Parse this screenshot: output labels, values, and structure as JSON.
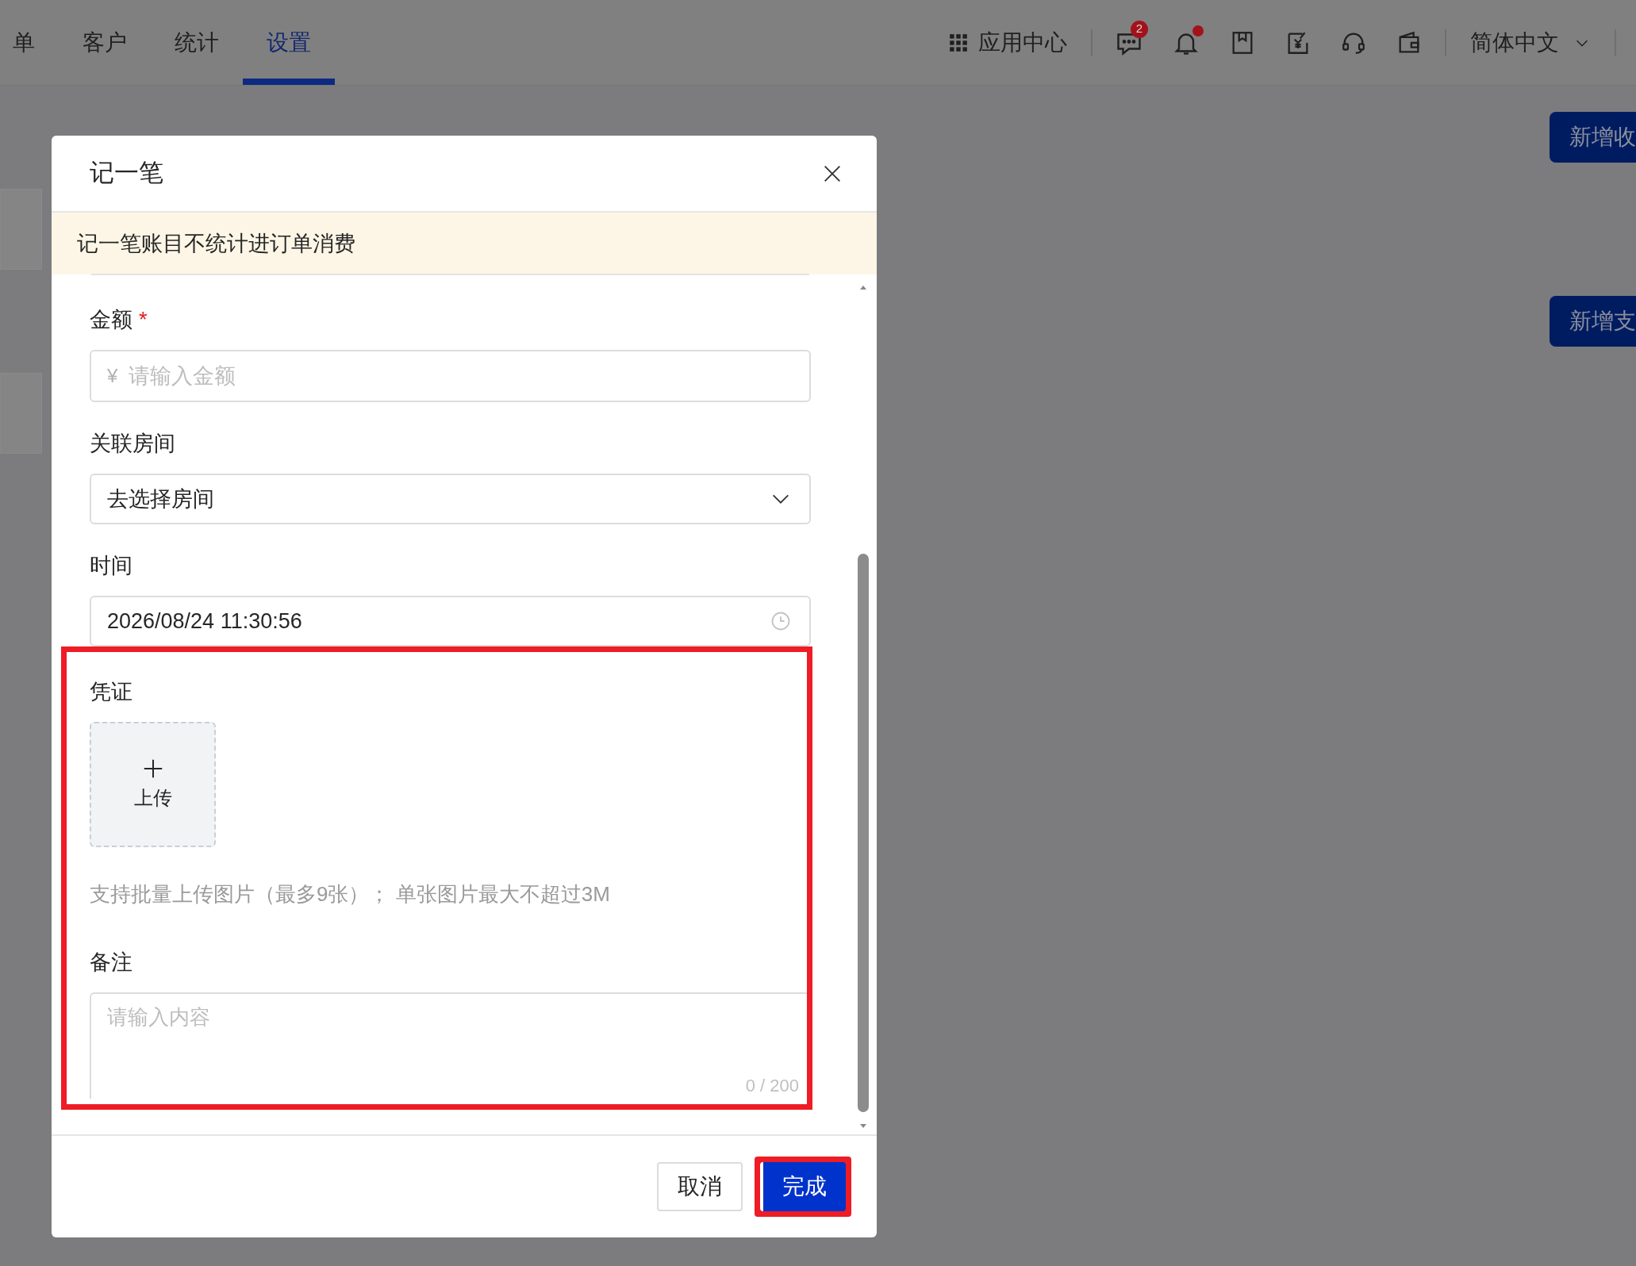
{
  "top_nav": {
    "tabs": [
      {
        "label": "单",
        "selected": false
      },
      {
        "label": "客户",
        "selected": false
      },
      {
        "label": "统计",
        "selected": false
      },
      {
        "label": "设置",
        "selected": true
      }
    ],
    "app_center": "应用中心",
    "message_badge": "2",
    "notification_dot": true,
    "language": "简体中文"
  },
  "page_buttons": [
    "新增收",
    "新增支"
  ],
  "dialog": {
    "title": "记一笔",
    "notice": "记一笔账目不统计进订单消费",
    "fields": [
      {
        "kind": "amount",
        "label": "金额",
        "required": true,
        "required_mark": "*",
        "prefix": "¥",
        "placeholder": "请输入金额",
        "highlighted": false
      },
      {
        "kind": "select",
        "label": "关联房间",
        "value": "去选择房间",
        "highlighted": false
      },
      {
        "kind": "datetime",
        "label": "时间",
        "value": "2026/08/24 11:30:56",
        "highlighted": false
      },
      {
        "kind": "upload",
        "label": "凭证",
        "button": "上传",
        "hint": "支持批量上传图片（最多9张）； 单张图片最大不超过3M",
        "highlighted": true
      },
      {
        "kind": "textarea",
        "label": "备注",
        "placeholder": "请输入内容",
        "counter": "0 / 200",
        "highlighted": true
      }
    ],
    "buttons": [
      {
        "label": "取消",
        "primary": false,
        "highlighted": false
      },
      {
        "label": "完成",
        "primary": true,
        "highlighted": true
      }
    ]
  }
}
